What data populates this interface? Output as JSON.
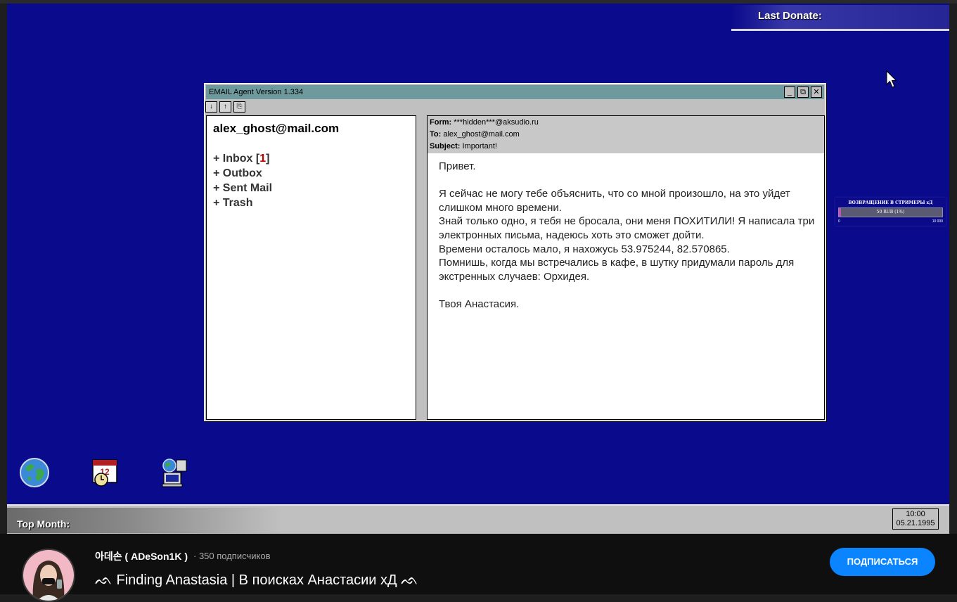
{
  "overlay": {
    "last_donate_label": "Last Donate:",
    "top_month_label": "Top Month:",
    "goal": {
      "title": "ВОЗВРАЩЕНИЕ В СТРИМЕРЫ хД",
      "progress_text": "50 RUB (1%)",
      "progress": 0.01,
      "min": "0",
      "max": "10 000"
    }
  },
  "window": {
    "title": "EMAIL Agent Version 1.334",
    "controls": {
      "minimize": "_",
      "restore": "⧉",
      "close": "✕"
    },
    "toolbar": {
      "download": "↓",
      "upload": "↑",
      "copy": "⎘"
    }
  },
  "sidebar": {
    "account": "alex_ghost@mail.com",
    "folders": [
      {
        "prefix": "+ Inbox [",
        "count": "1",
        "suffix": "]"
      },
      {
        "label": "+ Outbox"
      },
      {
        "label": "+ Sent Mail"
      },
      {
        "label": "+ Trash"
      }
    ]
  },
  "message": {
    "from_label": "Form:",
    "from": "***hidden***@aksudio.ru",
    "to_label": "To:",
    "to": "alex_ghost@mail.com",
    "subject_label": "Subject:",
    "subject": "Important!",
    "greeting": "Привет.",
    "para1": "Я сейчас не могу тебе объяснить, что со мной произошло, на это уйдет слишком много времени.",
    "para2": "Знай только одно, я тебя не бросала, они меня ПОХИТИЛИ! Я написала три электронных письма, надеюсь хоть это сможет дойти.",
    "para3": "Времени осталось мало, я нахожусь 53.975244, 82.570865.",
    "para4": "Помнишь, когда мы встречались в кафе, в шутку придумали пароль для экстренных случаев: Орхидея.",
    "signature": "Твоя Анастасия."
  },
  "desktop_icons": [
    "globe-icon",
    "calendar-clock-icon",
    "network-computer-icon"
  ],
  "taskbar": {
    "time": "10:00",
    "date": "05.21.1995"
  },
  "youtube": {
    "channel": "아데손 ( ADeSon1K )",
    "subscribers": "· 350 подписчиков",
    "video_title": "ᨒ Finding Anastasia | В поисках Анастасии хД ᨒ",
    "subscribe_label": "ПОДПИСАТЬСЯ"
  },
  "colors": {
    "desktop": "#0a0a8c",
    "titlebar": "#6e9a9e",
    "subscribe": "#0a84ff",
    "inbox_count": "#c00000"
  }
}
